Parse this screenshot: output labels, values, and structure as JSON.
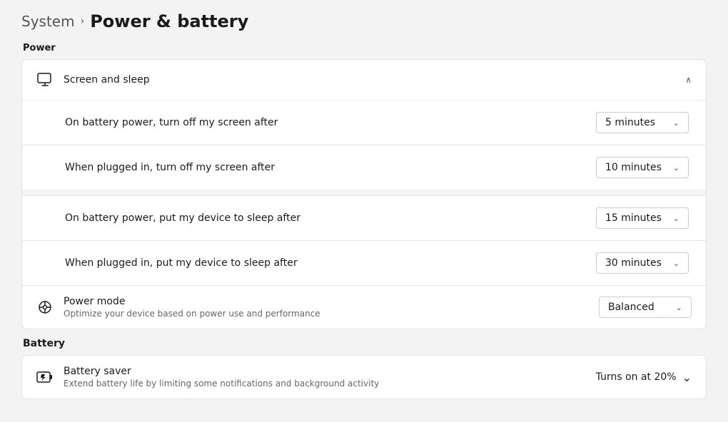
{
  "breadcrumb": {
    "system_label": "System",
    "chevron": "›",
    "current": "Power & battery"
  },
  "power_section": {
    "label": "Power",
    "screen_sleep": {
      "title": "Screen and sleep",
      "rows": [
        {
          "label": "On battery power, turn off my screen after",
          "value": "5 minutes"
        },
        {
          "label": "When plugged in, turn off my screen after",
          "value": "10 minutes"
        },
        {
          "label": "On battery power, put my device to sleep after",
          "value": "15 minutes"
        },
        {
          "label": "When plugged in, put my device to sleep after",
          "value": "30 minutes"
        }
      ]
    },
    "power_mode": {
      "title": "Power mode",
      "subtitle": "Optimize your device based on power use and performance",
      "value": "Balanced"
    }
  },
  "battery_section": {
    "label": "Battery",
    "battery_saver": {
      "title": "Battery saver",
      "subtitle": "Extend battery life by limiting some notifications and background activity",
      "value": "Turns on at 20%"
    }
  },
  "icons": {
    "screen_sleep": "⬜",
    "power_mode": "⚡",
    "battery_saver": "🔋",
    "chevron_up": "∧",
    "chevron_down": "∨"
  }
}
